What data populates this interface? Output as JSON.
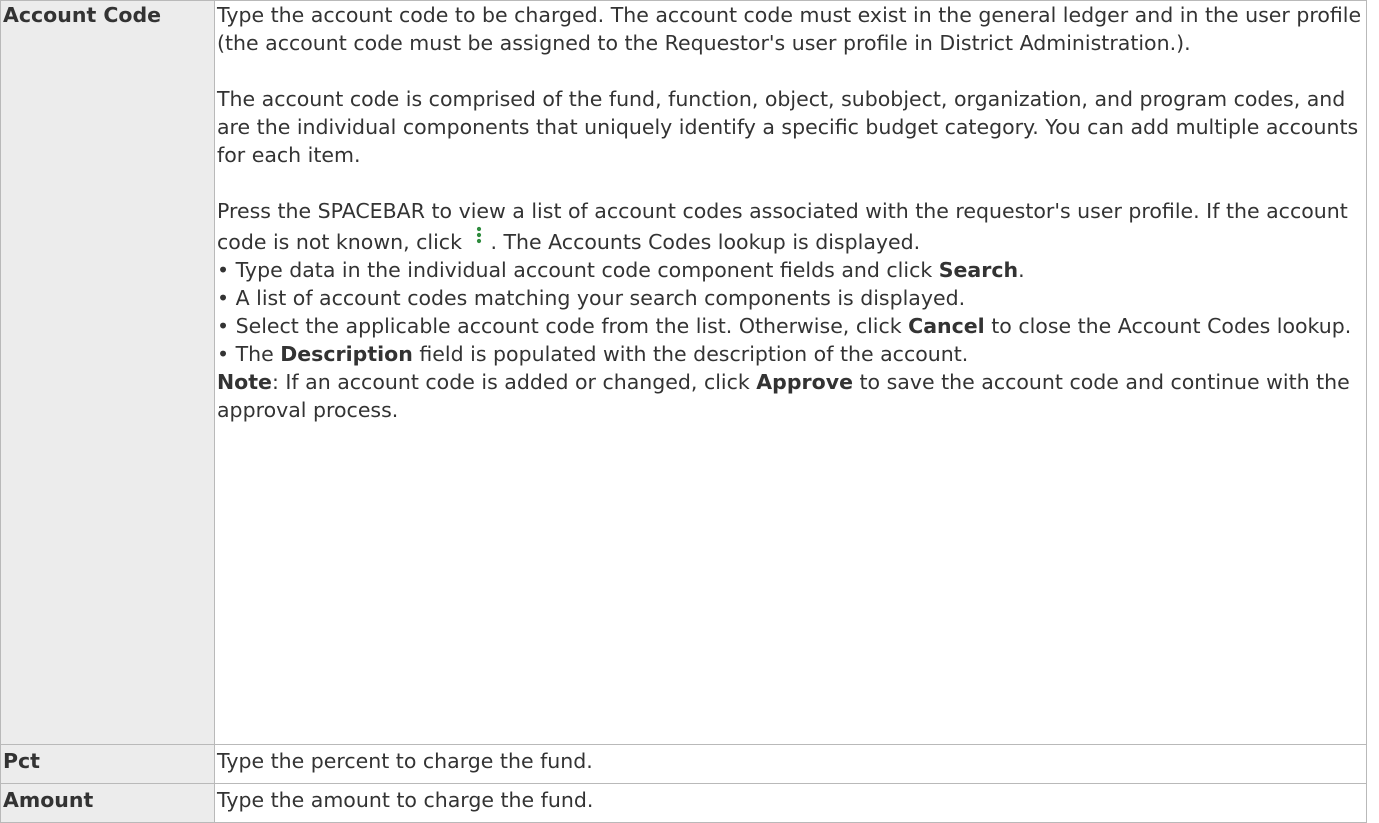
{
  "rows": [
    {
      "label": "Account Code",
      "paragraphs": [
        "Type the account code to be charged. The account code must exist in the general ledger and in the user profile (the account code must be assigned to the Requestor's user profile in District Administration.).",
        "The account code is comprised of the fund, function, object, subobject, organization, and program codes, and are the individual components that uniquely identify a specific budget category. You can add multiple accounts for each item."
      ],
      "lookup": {
        "before_icon": "Press the SPACEBAR to view a list of account codes associated with the requestor's user profile. If the account code is not known, click ",
        "icon": "kebab-vertical-icon",
        "after_icon": ". The Accounts Codes lookup is displayed."
      },
      "bullets": [
        {
          "pre": "• Type data in the individual account code component fields and click ",
          "bold": "Search",
          "post": "."
        },
        {
          "pre": "• A list of account codes matching your search components is displayed.",
          "bold": "",
          "post": ""
        },
        {
          "pre": "• Select the applicable account code from the list. Otherwise, click ",
          "bold": "Cancel",
          "post": " to close the Account Codes lookup."
        },
        {
          "pre": "• The ",
          "bold": "Description",
          "post": " field is populated with the description of the account."
        }
      ],
      "note": {
        "label": "Note",
        "pre": ": If an account code is added or changed, click ",
        "bold": "Approve",
        "post": " to save the account code and continue with the approval process."
      }
    },
    {
      "label": "Pct",
      "description": "Type the percent to charge the fund."
    },
    {
      "label": "Amount",
      "description": "Type the amount to charge the fund."
    }
  ],
  "colors": {
    "label_background": "#ececec",
    "border": "#b9b9b9",
    "text": "#333333",
    "icon_green": "#2e8b3d"
  }
}
